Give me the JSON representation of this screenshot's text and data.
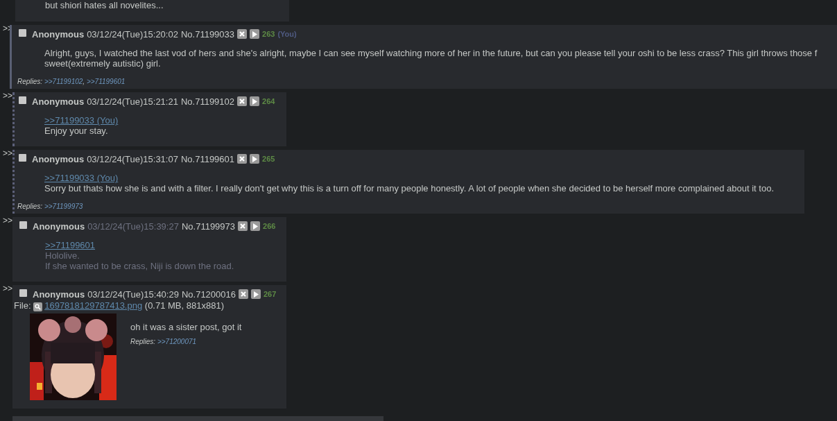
{
  "partial_post": {
    "lines": [
      "but shiori hates all novelites..."
    ]
  },
  "posts": [
    {
      "side": ">>",
      "name": "Anonymous",
      "date": "03/12/24(Tue)15:20:02",
      "number": "No.71199033",
      "count": "263",
      "you": "(You)",
      "own": true,
      "quotes_you": false,
      "dimmed": false,
      "lines": [
        {
          "kind": "text",
          "text": "Alright, guys, I watched the last vod of hers and she's alright, maybe I can see myself watching more of her in the future, but can you please tell your oshi to be less crass? This girl throws those f"
        },
        {
          "kind": "text",
          "text": "sweet(extremely autistic) girl."
        }
      ],
      "replies": {
        "label": "Replies:",
        "links": [
          {
            "text": ">>71199102",
            "sep": ","
          },
          {
            "text": ">>71199601"
          }
        ]
      }
    },
    {
      "side": ">>",
      "name": "Anonymous",
      "date": "03/12/24(Tue)15:21:21",
      "number": "No.71199102",
      "count": "264",
      "own": false,
      "quotes_you": true,
      "dimmed": false,
      "lines": [
        {
          "kind": "quote",
          "text": ">>71199033 (You)"
        },
        {
          "kind": "text",
          "text": "Enjoy your stay."
        }
      ]
    },
    {
      "side": ">>",
      "name": "Anonymous",
      "date": "03/12/24(Tue)15:31:07",
      "number": "No.71199601",
      "count": "265",
      "own": false,
      "quotes_you": true,
      "dimmed": false,
      "lines": [
        {
          "kind": "quote",
          "text": ">>71199033 (You)"
        },
        {
          "kind": "text",
          "text": "Sorry but thats how she is and with a filter. I really don't get why this is a turn off for many people honestly. A lot of people when she decided to be herself more complained about it too."
        }
      ],
      "replies": {
        "label": "Replies:",
        "links": [
          {
            "text": ">>71199973"
          }
        ]
      }
    },
    {
      "side": ">>",
      "name": "Anonymous",
      "date": "03/12/24(Tue)15:39:27",
      "number": "No.71199973",
      "count": "266",
      "own": false,
      "quotes_you": false,
      "dimmed": true,
      "lines": [
        {
          "kind": "quote",
          "text": ">>71199601"
        },
        {
          "kind": "text",
          "text": "Hololive."
        },
        {
          "kind": "text",
          "text": "If she wanted to be crass, Niji is down the road."
        }
      ]
    },
    {
      "side": ">>",
      "name": "Anonymous",
      "date": "03/12/24(Tue)15:40:29",
      "number": "No.71200016",
      "count": "267",
      "own": false,
      "quotes_you": false,
      "dimmed": false,
      "file": {
        "label": "File:",
        "filename": "1697818129787413.png",
        "info": "(0.71 MB, 881x881)"
      },
      "lines": [
        {
          "kind": "text",
          "text": "oh it was a sister post, got it"
        }
      ],
      "replies": {
        "label": "Replies:",
        "links": [
          {
            "text": ">>71200071"
          }
        ]
      }
    }
  ]
}
